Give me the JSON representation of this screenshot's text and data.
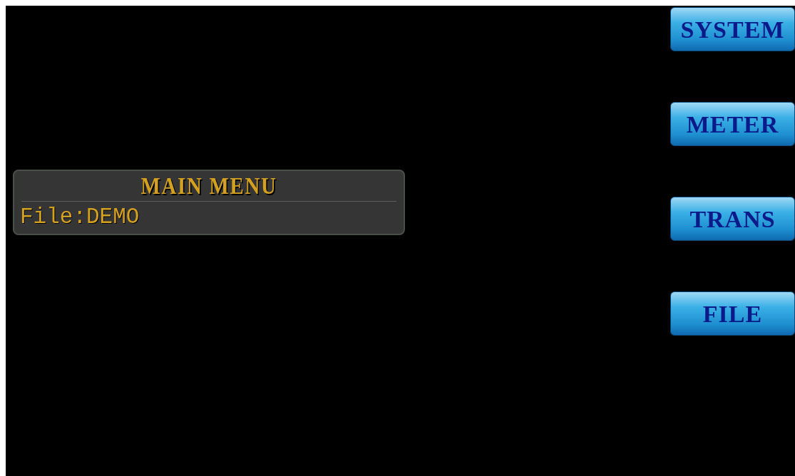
{
  "panel": {
    "title": "MAIN MENU",
    "file_label": "File:DEMO"
  },
  "buttons": [
    "SYSTEM",
    "METER",
    "TRANS",
    "FILE"
  ]
}
